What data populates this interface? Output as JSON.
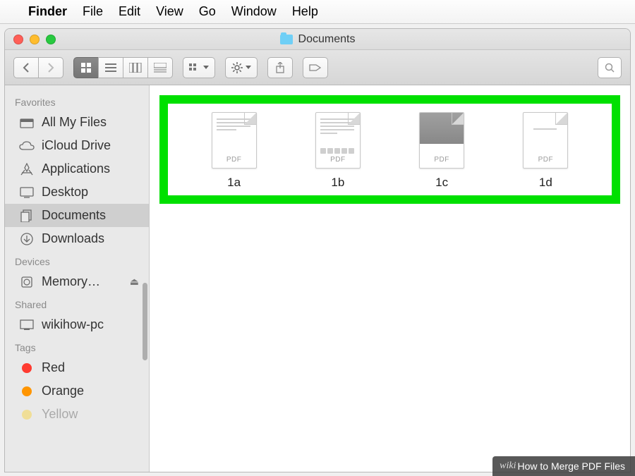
{
  "menubar": {
    "app_name": "Finder",
    "items": [
      "File",
      "Edit",
      "View",
      "Go",
      "Window",
      "Help"
    ]
  },
  "window": {
    "title": "Documents"
  },
  "sidebar": {
    "sections": [
      {
        "label": "Favorites",
        "items": [
          {
            "icon": "all-my-files",
            "label": "All My Files"
          },
          {
            "icon": "icloud",
            "label": "iCloud Drive"
          },
          {
            "icon": "applications",
            "label": "Applications"
          },
          {
            "icon": "desktop",
            "label": "Desktop"
          },
          {
            "icon": "documents",
            "label": "Documents",
            "selected": true
          },
          {
            "icon": "downloads",
            "label": "Downloads"
          }
        ]
      },
      {
        "label": "Devices",
        "items": [
          {
            "icon": "disk",
            "label": "Memory…",
            "eject": true
          }
        ]
      },
      {
        "label": "Shared",
        "items": [
          {
            "icon": "pc",
            "label": "wikihow-pc"
          }
        ]
      },
      {
        "label": "Tags",
        "items": [
          {
            "icon": "tag",
            "color": "red",
            "label": "Red"
          },
          {
            "icon": "tag",
            "color": "orange",
            "label": "Orange"
          },
          {
            "icon": "tag",
            "color": "yellow",
            "label": "Yellow"
          }
        ]
      }
    ]
  },
  "files": [
    {
      "name": "1a",
      "ext": "PDF"
    },
    {
      "name": "1b",
      "ext": "PDF"
    },
    {
      "name": "1c",
      "ext": "PDF"
    },
    {
      "name": "1d",
      "ext": "PDF"
    }
  ],
  "caption": {
    "prefix": "wiki",
    "text": "How to Merge PDF Files"
  }
}
